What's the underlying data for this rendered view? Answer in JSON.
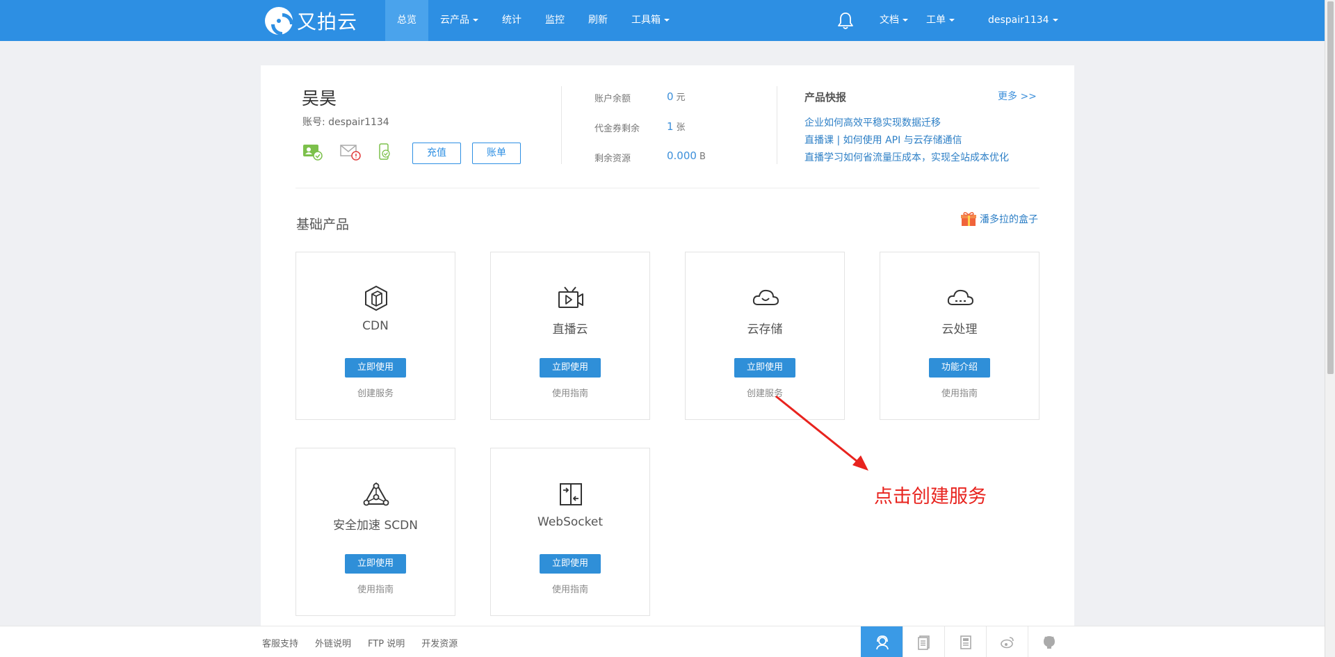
{
  "brand": {
    "name": "又拍云"
  },
  "nav": {
    "items": [
      {
        "label": "总览",
        "active": true,
        "dropdown": false
      },
      {
        "label": "云产品",
        "active": false,
        "dropdown": true
      },
      {
        "label": "统计",
        "active": false,
        "dropdown": false
      },
      {
        "label": "监控",
        "active": false,
        "dropdown": false
      },
      {
        "label": "刷新",
        "active": false,
        "dropdown": false
      },
      {
        "label": "工具箱",
        "active": false,
        "dropdown": true
      }
    ],
    "right": {
      "docs": "文档",
      "ticket": "工单",
      "user": "despair1134"
    }
  },
  "account": {
    "name": "吴昊",
    "number": "账号: despair1134",
    "recharge_label": "充值",
    "bill_label": "账单"
  },
  "balance": {
    "rows": [
      {
        "label": "账户余额",
        "value": "0",
        "unit": "元"
      },
      {
        "label": "代金券剩余",
        "value": "1",
        "unit": "张"
      },
      {
        "label": "剩余资源",
        "value": "0.000",
        "unit": "B"
      }
    ]
  },
  "news": {
    "title": "产品快报",
    "more": "更多 >>",
    "items": [
      "企业如何高效平稳实现数据迁移",
      "直播课 | 如何使用 API 与云存储通信",
      "直播学习如何省流量压成本，实现全站成本优化"
    ]
  },
  "products": {
    "section_title": "基础产品",
    "pandora": "潘多拉的盒子",
    "cards": [
      {
        "title": "CDN",
        "button": "立即使用",
        "link": "创建服务",
        "icon": "cdn-icon"
      },
      {
        "title": "直播云",
        "button": "立即使用",
        "link": "使用指南",
        "icon": "live-tv-icon"
      },
      {
        "title": "云存储",
        "button": "立即使用",
        "link": "创建服务",
        "icon": "cloud-storage-icon"
      },
      {
        "title": "云处理",
        "button": "功能介绍",
        "link": "使用指南",
        "icon": "cloud-process-icon"
      },
      {
        "title": "安全加速 SCDN",
        "button": "立即使用",
        "link": "使用指南",
        "icon": "scdn-icon"
      },
      {
        "title": "WebSocket",
        "button": "立即使用",
        "link": "使用指南",
        "icon": "websocket-icon"
      }
    ]
  },
  "annotation": {
    "text": "点击创建服务",
    "color": "#e8231e"
  },
  "footer": {
    "links": [
      "客服支持",
      "外链说明",
      "FTP 说明",
      "开发资源"
    ],
    "icons": [
      "support-icon",
      "docs-icon",
      "manual-icon",
      "weibo-icon",
      "github-icon"
    ]
  },
  "colors": {
    "brand": "#2d8fe3",
    "link": "#2d7fc6",
    "button": "#2f8fd8"
  }
}
